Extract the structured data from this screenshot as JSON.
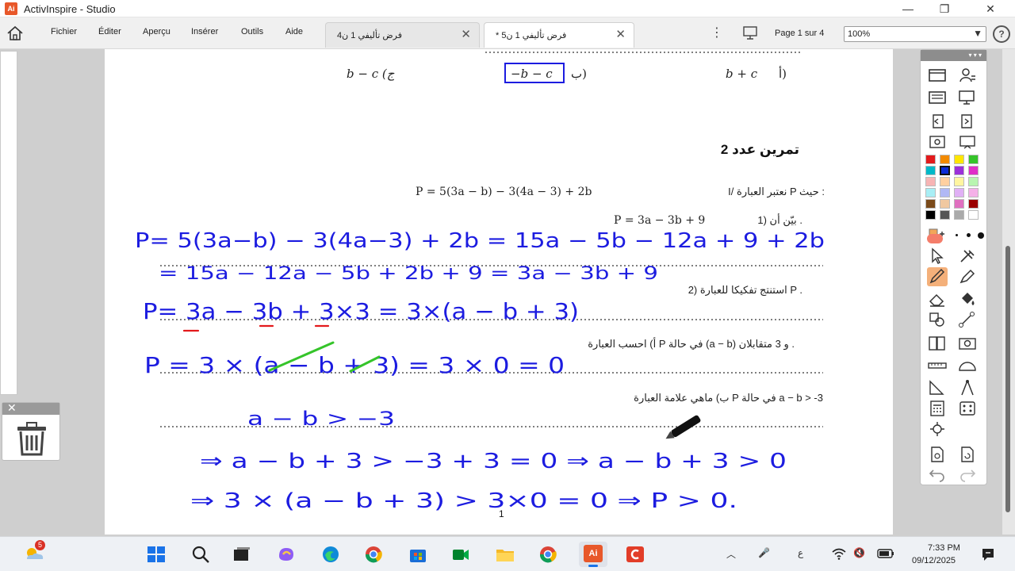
{
  "window": {
    "title": "ActivInspire - Studio",
    "logo": "Ai"
  },
  "menu": [
    "Fichier",
    "Éditer",
    "Aperçu",
    "Insérer",
    "Outils",
    "Aide"
  ],
  "tabs": [
    {
      "label": "فرض تأليفي 1 ن4"
    },
    {
      "label": "* فرض تأليفي 1 ن5"
    }
  ],
  "page_indicator": "Page 1 sur 4",
  "zoom": "100%",
  "doc": {
    "choices": [
      "b − c (ج",
      "−b − c",
      "ب)",
      "b + c",
      "أ)"
    ],
    "exercise_title": "تمرين عدد 2",
    "q_intro_label": "I/ نعتبر العبارة P حيث :",
    "q_intro_expr": "P = 5(3a − b) − 3(4a − 3) + 2b",
    "q1_label": "1) بيّن أن .",
    "q1_expr": "P = 3a − 3b + 9",
    "q2_label": "2) استنتج تفكيكا للعبارة P .",
    "qa_label": "أ) احسب العبارة P في حالة (a − b) و 3 متقابلان .",
    "qb_label": "ب) ماهي علامة العبارة P في حالة a − b > -3",
    "page_number": "1"
  },
  "handwriting": {
    "line1": "P= 5(3a−b) − 3(4a−3) + 2b = 15a − 5b − 12a + 9 + 2b",
    "line2": "= 15a − 12a − 5b + 2b + 9 = 3a − 3b + 9",
    "line3": "P= 3a − 3b + 3×3 = 3×(a − b + 3)",
    "line4": "P = 3 × (a − b + 3) = 3 × 0 = 0",
    "line5": "a − b > −3",
    "line6": "⇒ a − b + 3 > −3 + 3 = 0 ⇒ a − b + 3 > 0",
    "line7": "⇒ 3 × (a − b + 3) > 3×0 = 0 ⇒ P > 0."
  },
  "taskbar": {
    "weather_badge": "5",
    "lang": "ع",
    "time": "7:33 PM",
    "date": "09/12/2025"
  },
  "colors": {
    "ink": "#1c1ce0",
    "accent": "#e8582a",
    "palette": [
      "#e31a1c",
      "#f28a00",
      "#ffe600",
      "#35c42a",
      "#00b8c8",
      "#0a2bd6",
      "#9b30d9",
      "#e02ec8",
      "#f7b4b4",
      "#ffd0a0",
      "#fff5a0",
      "#b8f5b0",
      "#a8eef5",
      "#b0b8f5",
      "#e0b0f5",
      "#f5b0e8",
      "#7a4a1a",
      "#f0c8a0",
      "#e070c0",
      "#9b0000",
      "#000000",
      "#555555",
      "#aaaaaa",
      "#ffffff"
    ]
  }
}
